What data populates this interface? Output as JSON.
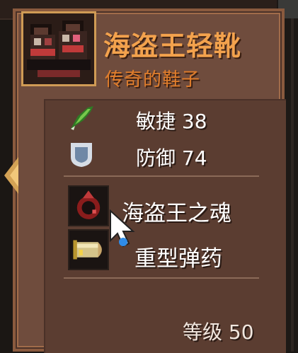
{
  "item": {
    "name": "海盗王轻靴",
    "subtitle": "传奇的鞋子",
    "icon": "pirate-boots-icon"
  },
  "stats": [
    {
      "icon": "feather-icon",
      "label": "敏捷 38",
      "color": "#76c84b"
    },
    {
      "icon": "shield-icon",
      "label": "防御 74",
      "color": "#8aa6c4"
    }
  ],
  "effects": [
    {
      "icon": "pirate-soul-icon",
      "label": "海盗王之魂"
    },
    {
      "icon": "heavy-ammo-icon",
      "label": "重型弹药"
    }
  ],
  "level": "等级 50",
  "colors": {
    "name": "#f3a24d",
    "subtitle": "#e07d2b",
    "panel": "#5b3d31",
    "frame": "#d09b55"
  }
}
